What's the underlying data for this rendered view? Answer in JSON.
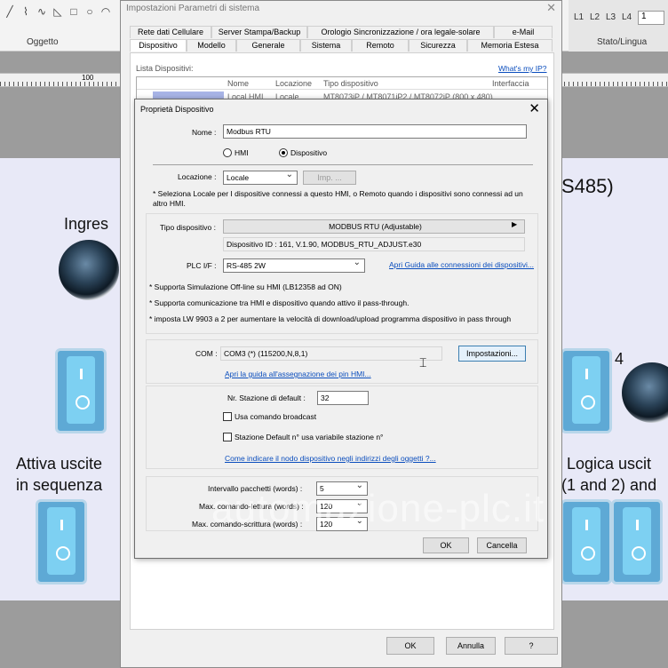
{
  "editor": {
    "group_oggetto": "Oggetto",
    "group_stato": "Stato/Lingua",
    "lang_buttons": [
      "L1",
      "L2",
      "L3",
      "L4"
    ],
    "lang_value": "1",
    "ruler_label": "100",
    "labels": {
      "ingressi": "Ingres",
      "rs485": "S485)",
      "attiva": "Attiva uscite\nin sequenza",
      "logica": "Logica uscit\n(1 and 2) and",
      "num4": "4"
    }
  },
  "outer": {
    "title": "Impostazioni Parametri di sistema",
    "tabs_row1": [
      "Rete dati Cellulare",
      "Server Stampa/Backup",
      "Orologio Sincronizzazione / ora legale-solare",
      "e-Mail"
    ],
    "tabs_row2": [
      "Dispositivo",
      "Modello",
      "Generale",
      "Sistema",
      "Remoto",
      "Sicurezza",
      "Memoria Estesa"
    ],
    "list_label": "Lista Dispositivi:",
    "whats_my_ip": "What's my IP?",
    "list_headers": [
      "Nome",
      "Locazione",
      "Tipo dispositivo",
      "Interfaccia"
    ],
    "list_row": [
      "Local HMI",
      "Locale",
      "MT8073iP / MT8071iP2 / MT8072iP (800 x 480)",
      ""
    ],
    "ok": "OK",
    "annulla": "Annulla",
    "help": "?"
  },
  "inner": {
    "title": "Proprietà Dispositivo",
    "nome_label": "Nome :",
    "nome_value": "Modbus RTU",
    "radio_hmi": "HMI",
    "radio_disp": "Dispositivo",
    "locazione_label": "Locazione :",
    "locazione_value": "Locale",
    "imp_button": "Imp. ...",
    "locazione_note": "* Seleziona Locale per I dispositive connessi a questo HMI, o Remoto quando i dispositivi sono connessi ad un altro HMI.",
    "tipo_label": "Tipo dispositivo :",
    "tipo_value": "MODBUS RTU (Adjustable)",
    "device_id": "Dispositivo ID : 161, V.1.90, MODBUS_RTU_ADJUST.e30",
    "plc_label": "PLC I/F :",
    "plc_value": "RS-485 2W",
    "plc_link": "Apri Guida alle connessioni dei dispositivi...",
    "note1": "* Supporta Simulazione Off-line su HMI (LB12358 ad ON)",
    "note2": "* Supporta comunicazione tra HMI e dispositivo quando attivo il pass-through.",
    "note3": "* imposta LW 9903 a 2 per aumentare la velocità di download/upload programma dispositivo in pass through",
    "com_label": "COM :",
    "com_value": "COM3 (*) (115200,N,8,1)",
    "impostazioni_button": "Impostazioni...",
    "pin_link": "Apri la guida all'assegnazione dei pin HMI...",
    "stazione_label": "Nr. Stazione di default :",
    "stazione_value": "32",
    "broadcast_label": "Usa comando broadcast",
    "stazione_var_label": "Stazione Default n° usa variabile stazione n°",
    "indirizzo_link": "Come indicare il nodo dispositivo negli indirizzi degli oggetti ?...",
    "intervallo_label": "Intervallo pacchetti (words) :",
    "intervallo_value": "5",
    "lettura_label": "Max. comando-lettura (words) :",
    "lettura_value": "120",
    "scrittura_label": "Max. comando-scrittura (words) :",
    "scrittura_value": "120",
    "ok": "OK",
    "cancella": "Cancella"
  },
  "watermark": "automazione-plc.it"
}
